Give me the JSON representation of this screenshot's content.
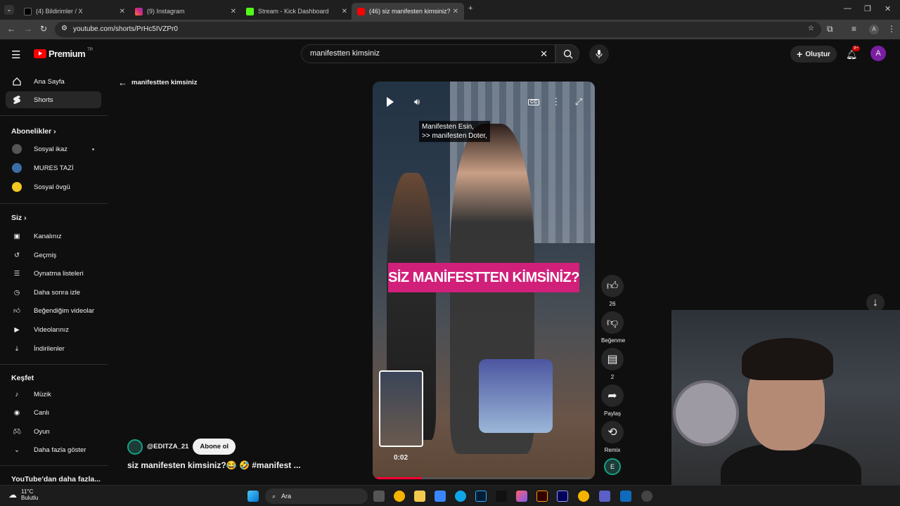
{
  "browser": {
    "tabs": [
      {
        "title": "(4) Bildirimler / X",
        "fav": "x-logo"
      },
      {
        "title": "(9) Instagram",
        "fav": "instagram-logo"
      },
      {
        "title": "Stream - Kick Dashboard",
        "fav": "kick-logo"
      },
      {
        "title": "(46) siz manifesten kimsiniz?",
        "fav": "youtube-logo"
      }
    ],
    "url": "youtube.com/shorts/PrHc5IVZPr0"
  },
  "header": {
    "logo": "Premium",
    "region": "TR",
    "search_value": "manifestten kimsiniz",
    "create_label": "Oluştur",
    "notif_badge": "9+",
    "avatar_letter": "A"
  },
  "sidebar": {
    "main": [
      {
        "label": "Ana Sayfa",
        "icon": "home-icon"
      },
      {
        "label": "Shorts",
        "icon": "shorts-icon"
      }
    ],
    "subs_heading": "Abonelikler",
    "subs": [
      {
        "label": "Sosyal ikaz",
        "color": "#555"
      },
      {
        "label": "MURES TAZİ",
        "color": "#3b6ea5"
      },
      {
        "label": "Sosyal övgü",
        "color": "#f3c623"
      }
    ],
    "you_heading": "Siz",
    "you": [
      {
        "label": "Kanalınız",
        "icon": "channel-icon"
      },
      {
        "label": "Geçmiş",
        "icon": "history-icon"
      },
      {
        "label": "Oynatma listeleri",
        "icon": "playlists-icon"
      },
      {
        "label": "Daha sonra izle",
        "icon": "watch-later-icon"
      },
      {
        "label": "Beğendiğim videolar",
        "icon": "like-icon"
      },
      {
        "label": "Videolarınız",
        "icon": "your-videos-icon"
      },
      {
        "label": "İndirilenler",
        "icon": "download-icon"
      }
    ],
    "explore_heading": "Keşfet",
    "explore": [
      {
        "label": "Müzik",
        "icon": "music-icon"
      },
      {
        "label": "Canlı",
        "icon": "live-icon"
      },
      {
        "label": "Oyun",
        "icon": "gaming-icon"
      },
      {
        "label": "Daha fazla göster",
        "icon": "chevron-down-icon"
      }
    ],
    "more_heading": "YouTube'dan daha fazla..."
  },
  "main": {
    "back_label": "manifestten kimsiniz",
    "caption_line1": "Manifesten Esin,",
    "caption_line2": ">> manifesten Doter,",
    "banner": "SİZ MANİFESTTEN KİMSİNİZ?",
    "time": "0:02",
    "progress": 0.22,
    "channel": "@EDITZA_21",
    "subscribe_label": "Abone ol",
    "title": "siz manifesten kimsiniz?😂 🤣 #manifest ..."
  },
  "actions": {
    "likes": "26",
    "dislike_label": "Beğenme",
    "comments": "2",
    "share_label": "Paylaş",
    "remix_label": "Remix"
  },
  "taskbar": {
    "temp": "11°C",
    "weather": "Bulutlu",
    "search_placeholder": "Ara"
  },
  "colors": {
    "accent": "#ff0033",
    "banner": "#d1207a"
  }
}
